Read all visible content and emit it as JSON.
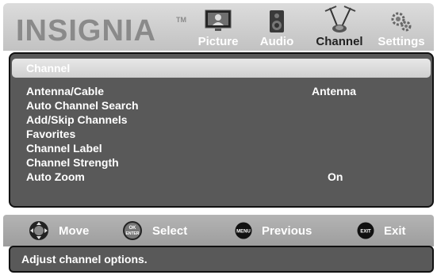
{
  "header": {
    "brand": "INSIGNIA",
    "brand_tm": "TM",
    "tabs": [
      {
        "label": "Picture",
        "icon": "picture-icon"
      },
      {
        "label": "Audio",
        "icon": "speaker-icon"
      },
      {
        "label": "Channel",
        "icon": "antenna-icon",
        "active": true
      },
      {
        "label": "Settings",
        "icon": "gears-icon"
      }
    ]
  },
  "main": {
    "section_title": "Channel",
    "items": [
      {
        "label": "Antenna/Cable",
        "value": "Antenna"
      },
      {
        "label": "Auto Channel Search"
      },
      {
        "label": "Add/Skip Channels"
      },
      {
        "label": "Favorites"
      },
      {
        "label": "Channel Label"
      },
      {
        "label": "Channel Strength"
      },
      {
        "label": "Auto Zoom",
        "value": "On"
      }
    ]
  },
  "nav": {
    "move": {
      "label": "Move",
      "icon": "dpad-icon"
    },
    "select": {
      "label": "Select",
      "icon": "ok-enter-icon",
      "icon_text_top": "OK",
      "icon_text_bottom": "ENTER"
    },
    "previous": {
      "label": "Previous",
      "icon": "menu-icon",
      "icon_text": "MENU"
    },
    "exit": {
      "label": "Exit",
      "icon": "exit-icon",
      "icon_text": "EXIT"
    }
  },
  "help": {
    "text": "Adjust channel options."
  },
  "colors": {
    "panel": "#595959",
    "header": "#c8c8c8",
    "nav": "#a8a8a8"
  }
}
